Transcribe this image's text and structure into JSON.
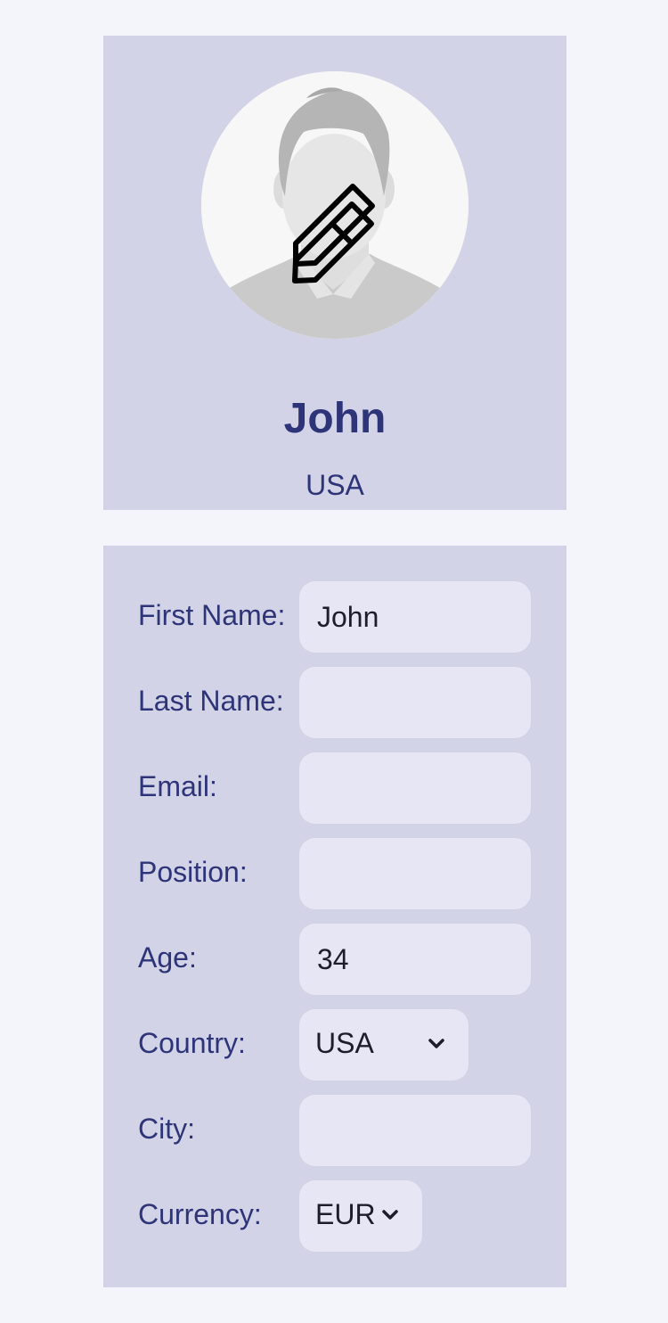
{
  "profile": {
    "name": "John",
    "country": "USA",
    "avatar_icon": "avatar-placeholder",
    "edit_icon": "pencil-icon"
  },
  "form": {
    "fields": [
      {
        "label": "First Name:",
        "value": "John"
      },
      {
        "label": "Last Name:",
        "value": ""
      },
      {
        "label": "Email:",
        "value": ""
      },
      {
        "label": "Position:",
        "value": ""
      },
      {
        "label": "Age:",
        "value": "34"
      },
      {
        "label": "City:",
        "value": ""
      }
    ],
    "country": {
      "label": "Country:",
      "value": "USA"
    },
    "currency": {
      "label": "Currency:",
      "value": "EUR"
    }
  },
  "colors": {
    "page_bg": "#f4f5fa",
    "card_bg": "#d3d3e7",
    "field_bg": "#e7e6f5",
    "text_accent": "#2e3478"
  }
}
